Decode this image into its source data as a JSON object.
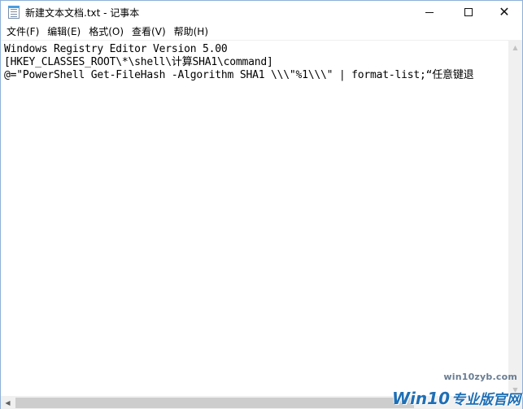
{
  "window": {
    "title": "新建文本文档.txt - 记事本"
  },
  "menu": [
    {
      "label": "文件(F)"
    },
    {
      "label": "编辑(E)"
    },
    {
      "label": "格式(O)"
    },
    {
      "label": "查看(V)"
    },
    {
      "label": "帮助(H)"
    }
  ],
  "editor": {
    "lines": [
      "Windows Registry Editor Version 5.00",
      "[HKEY_CLASSES_ROOT\\*\\shell\\计算SHA1\\command]",
      "@=\"PowerShell Get-FileHash -Algorithm SHA1 \\\\\\\"%1\\\\\\\" | format-list;“任意键退"
    ]
  },
  "watermark": {
    "url": "win10zyb.com",
    "brand": "Win10",
    "subtitle": "专业版官网"
  },
  "icons": {
    "app": "notepad-icon",
    "minimize": "minimize-icon",
    "maximize": "maximize-icon",
    "close": "close-icon"
  },
  "colors": {
    "window_border": "#8fb0d8",
    "watermark_blue": "#1f6fb5"
  }
}
